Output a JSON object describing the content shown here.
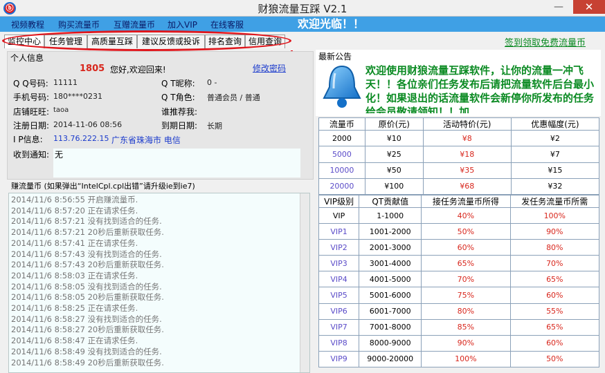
{
  "window": {
    "title": "财狼流量互踩  V2.1",
    "icon_text": "ⓑ",
    "close": "✕",
    "minimize": "—"
  },
  "menu": {
    "items": [
      "视频教程",
      "购买流量币",
      "互赠流量币",
      "加入VIP",
      "在线客服"
    ],
    "welcome": "欢迎光临！！"
  },
  "tabs": [
    "监控中心",
    "任务管理",
    "高质量互踩",
    "建议反馈或投诉",
    "排名查询",
    "信用查询"
  ],
  "free_link": "签到领取免费流量币",
  "profile": {
    "header": "个人信息",
    "user_id": "1805",
    "greeting": "您好,欢迎回来!",
    "change_password": "修改密码",
    "qq_label": "Q Q号码:",
    "qq_value": "11111",
    "qt_nick_label": "Q T昵称:",
    "qt_nick_value": "0 -",
    "phone_label": "手机号码:",
    "phone_value": "180****0231",
    "qt_role_label": "Q T角色:",
    "qt_role_value": "普通会员 / 普通",
    "shop_label": "店铺旺旺:",
    "shop_value": "taoa",
    "referrer_label": "谁推荐我:",
    "referrer_value": "",
    "reg_date_label": "注册日期:",
    "reg_date_value": "2014-11-06 08:56",
    "expire_label": "到期日期:",
    "expire_value": "长期",
    "ip_label": "I P信息:",
    "ip_value": "113.76.222.15",
    "ip_location": "广东省珠海市 电信",
    "notice_label": "收到通知:",
    "notice_value": "无"
  },
  "log": {
    "header": "赚流量币 (如果弹出“IntelCpl.cpl出错”请升级ie到ie7)",
    "lines": [
      "2014/11/6 8:56:55 开启赚流量币.",
      "2014/11/6 8:57:20 正在请求任务.",
      "2014/11/6 8:57:21 没有找到适合的任务.",
      "2014/11/6 8:57:21 20秒后重新获取任务.",
      "2014/11/6 8:57:41 正在请求任务.",
      "2014/11/6 8:57:43 没有找到适合的任务.",
      "2014/11/6 8:57:43 20秒后重新获取任务.",
      "2014/11/6 8:58:03 正在请求任务.",
      "2014/11/6 8:58:05 没有找到适合的任务.",
      "2014/11/6 8:58:05 20秒后重新获取任务.",
      "2014/11/6 8:58:25 正在请求任务.",
      "2014/11/6 8:58:27 没有找到适合的任务.",
      "2014/11/6 8:58:27 20秒后重新获取任务.",
      "2014/11/6 8:58:47 正在请求任务.",
      "2014/11/6 8:58:49 没有找到适合的任务.",
      "2014/11/6 8:58:49 20秒后重新获取任务."
    ]
  },
  "news": {
    "header": "最新公告",
    "text": "欢迎使用财狼流量互踩软件，让你的流量一冲飞天！！各位亲们任务发布后请把流量软件后台最小化！如果退出的话流量软件会新停你所发布的任务给会员敬请领知！！加"
  },
  "price_table": {
    "headers": [
      "流量币",
      "原价(元)",
      "活动特价(元)",
      "优惠幅度(元)"
    ],
    "rows": [
      [
        "2000",
        "¥10",
        "¥8",
        "¥2"
      ],
      [
        "5000",
        "¥25",
        "¥18",
        "¥7"
      ],
      [
        "10000",
        "¥50",
        "¥35",
        "¥15"
      ],
      [
        "20000",
        "¥100",
        "¥68",
        "¥32"
      ]
    ]
  },
  "vip_table": {
    "headers": [
      "VIP级别",
      "QT贡献值",
      "接任务流量币所得",
      "发任务流量币所需"
    ],
    "rows": [
      [
        "VIP",
        "1-1000",
        "40%",
        "100%"
      ],
      [
        "VIP1",
        "1001-2000",
        "50%",
        "90%"
      ],
      [
        "VIP2",
        "2001-3000",
        "60%",
        "80%"
      ],
      [
        "VIP3",
        "3001-4000",
        "65%",
        "70%"
      ],
      [
        "VIP4",
        "4001-5000",
        "70%",
        "65%"
      ],
      [
        "VIP5",
        "5001-6000",
        "75%",
        "60%"
      ],
      [
        "VIP6",
        "6001-7000",
        "80%",
        "55%"
      ],
      [
        "VIP7",
        "7001-8000",
        "85%",
        "65%"
      ],
      [
        "VIP8",
        "8000-9000",
        "90%",
        "60%"
      ],
      [
        "VIP9",
        "9000-20000",
        "100%",
        "50%"
      ]
    ]
  },
  "colors": {
    "menubar": "#3fa0e5",
    "accent_red": "#d8261c",
    "green": "#0a8a22",
    "blue_text": "#5a4bc8"
  }
}
